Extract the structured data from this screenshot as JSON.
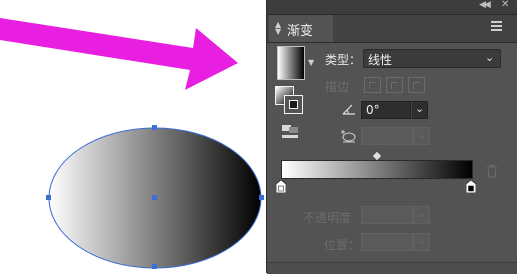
{
  "panel": {
    "title": "渐变",
    "type_label": "类型：",
    "type_value": "线性",
    "stroke_label": "描边",
    "angle_value": "0°",
    "opacity_label": "不透明度",
    "position_label": "位置："
  },
  "colors": {
    "arrow": "#e81ee0",
    "panel_bg": "#535353",
    "selection": "#3b6fd6",
    "gradient_start": "#ffffff",
    "gradient_end": "#000000"
  },
  "icons": {
    "collapse": "collapse-icon",
    "close": "close-icon",
    "menu": "panel-menu-icon",
    "angle": "angle-icon",
    "aspect": "aspect-ratio-icon",
    "delete": "trash-icon"
  }
}
